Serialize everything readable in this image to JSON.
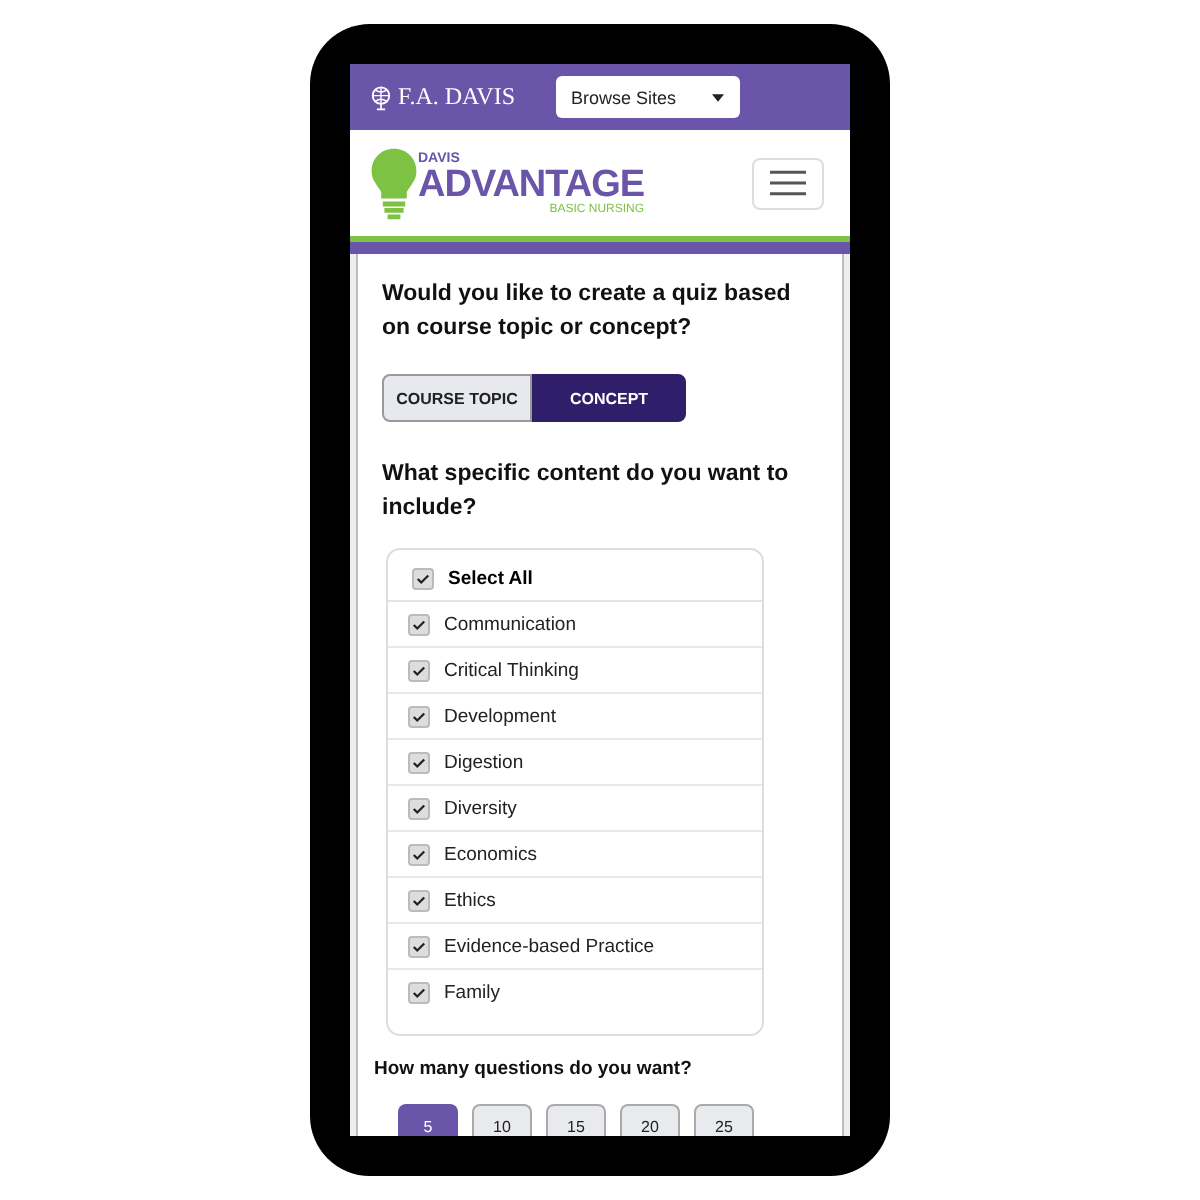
{
  "header": {
    "brand": "F.A. DAVIS",
    "site_menu": {
      "label": "Browse Sites"
    }
  },
  "logo": {
    "top": "DAVIS",
    "main": "ADVANTAGE",
    "sub": "BASIC NURSING"
  },
  "quiz_type": {
    "question": "Would you like to create a quiz based on course topic or concept?",
    "options": [
      {
        "label": "COURSE TOPIC",
        "selected": false
      },
      {
        "label": "CONCEPT",
        "selected": true
      }
    ]
  },
  "content": {
    "question": "What specific content do you want to include?",
    "select_all": {
      "label": "Select All",
      "checked": true
    },
    "items": [
      {
        "label": "Communication",
        "checked": true
      },
      {
        "label": "Critical Thinking",
        "checked": true
      },
      {
        "label": "Development",
        "checked": true
      },
      {
        "label": "Digestion",
        "checked": true
      },
      {
        "label": "Diversity",
        "checked": true
      },
      {
        "label": "Economics",
        "checked": true
      },
      {
        "label": "Ethics",
        "checked": true
      },
      {
        "label": "Evidence-based Practice",
        "checked": true
      },
      {
        "label": "Family",
        "checked": true
      }
    ]
  },
  "question_count": {
    "question": "How many questions do you want?",
    "options": [
      {
        "label": "5",
        "selected": true
      },
      {
        "label": "10",
        "selected": false
      },
      {
        "label": "15",
        "selected": false
      },
      {
        "label": "20",
        "selected": false
      },
      {
        "label": "25",
        "selected": false
      }
    ]
  }
}
